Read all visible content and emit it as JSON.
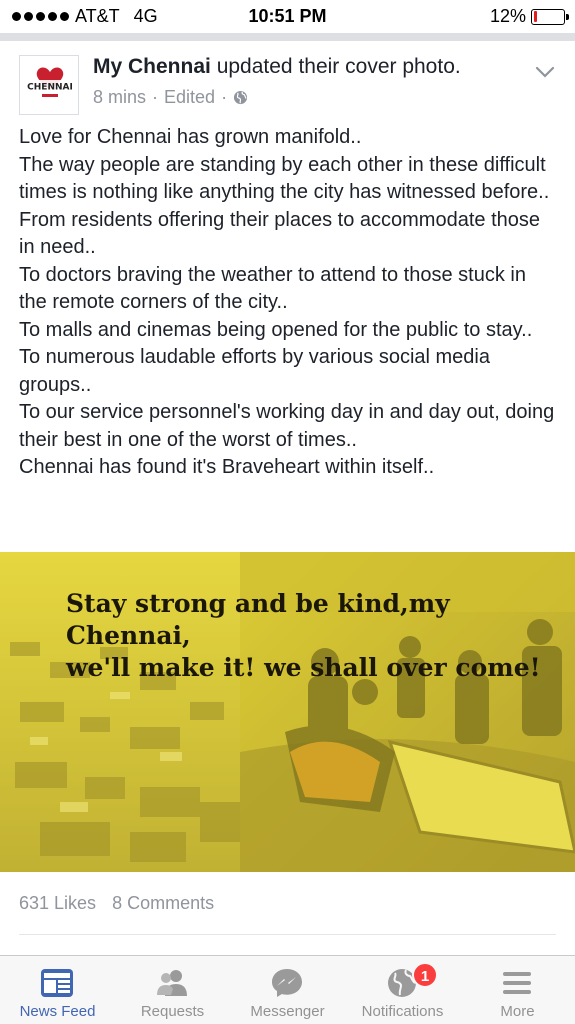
{
  "status_bar": {
    "carrier": "AT&T",
    "network": "4G",
    "time": "10:51 PM",
    "battery": "12%",
    "battery_level": 0.12,
    "battery_color": "#e02020"
  },
  "post": {
    "author": "My Chennai",
    "action": "updated their cover photo.",
    "time": "8 mins",
    "edited": "Edited",
    "privacy_icon": "globe-icon",
    "avatar_text": "CHENNAI",
    "menu_icon": "chevron-down-icon",
    "text_lines": [
      "Love for Chennai has grown manifold..",
      "The way people are standing by each other in these difficult times is nothing like anything the city has witnessed before..",
      "From residents offering their places to accommodate those in need..",
      "To doctors braving the weather to attend to those stuck in the remote corners of the city..",
      "To malls and cinemas being opened for the public to stay..",
      "To numerous laudable efforts by various social media groups..",
      "To our service personnel's working day in and day out, doing their best in one of the worst of times..",
      "Chennai has found it's Braveheart within itself.."
    ],
    "photo_caption_line1": "Stay strong and be kind,my Chennai,",
    "photo_caption_line2": "we'll make it! we shall over come!",
    "likes": "631 Likes",
    "comments": "8 Comments"
  },
  "tab_bar": {
    "tabs": [
      {
        "label": "News Feed",
        "icon": "news-feed-icon",
        "active": true
      },
      {
        "label": "Requests",
        "icon": "friend-requests-icon",
        "active": false
      },
      {
        "label": "Messenger",
        "icon": "messenger-icon",
        "active": false
      },
      {
        "label": "Notifications",
        "icon": "globe-icon",
        "active": false,
        "badge": "1"
      },
      {
        "label": "More",
        "icon": "menu-icon",
        "active": false
      }
    ]
  },
  "colors": {
    "brand": "#4267b2",
    "meta_text": "#90949c",
    "badge": "#fa3e3e",
    "photo_tint": "#d8c82e"
  }
}
